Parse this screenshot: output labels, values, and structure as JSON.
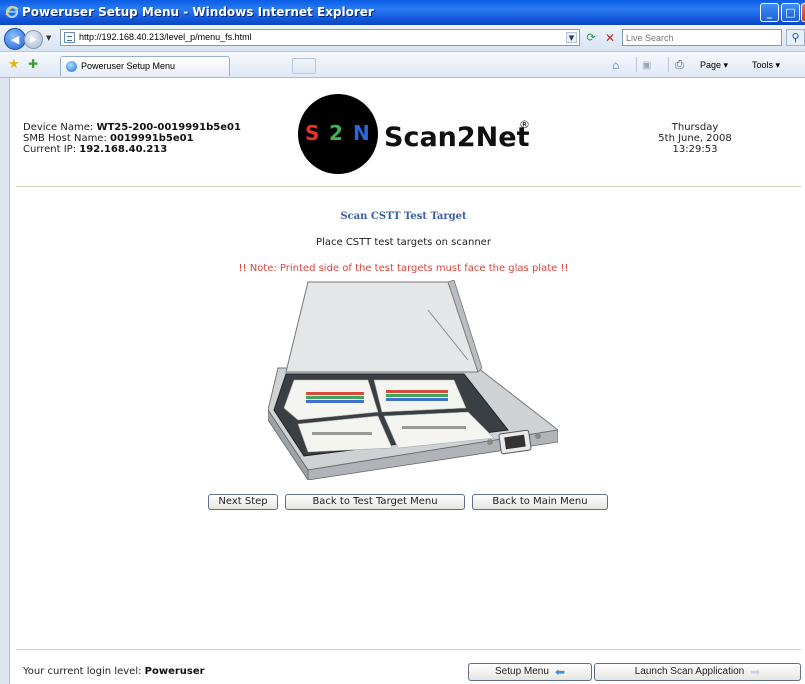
{
  "window": {
    "title": "Poweruser Setup Menu - Windows Internet Explorer"
  },
  "address_bar": {
    "url": "http://192.168.40.213/level_p/menu_fs.html",
    "search_placeholder": "Live Search"
  },
  "tabs": [
    {
      "label": "Poweruser Setup Menu"
    }
  ],
  "command_bar": {
    "page_label": "Page",
    "tools_label": "Tools"
  },
  "device": {
    "name_label": "Device Name:",
    "name_value": "WT25-200-0019991b5e01",
    "host_label": "SMB Host Name:",
    "host_value": "0019991b5e01",
    "ip_label": "Current IP:",
    "ip_value": "192.168.40.213"
  },
  "logo": {
    "s": "S",
    "two": "2",
    "n": "N",
    "text": "Scan2Net",
    "reg": "®"
  },
  "datetime": {
    "day": "Thursday",
    "date": "5th June, 2008",
    "time": "13:29:53"
  },
  "content": {
    "title": "Scan CSTT Test Target",
    "instruction": "Place CSTT test targets on scanner",
    "note": "!! Note: Printed side of the test targets must face the glas plate !!"
  },
  "buttons": {
    "next_step": "Next Step",
    "back_test_target": "Back to Test Target Menu",
    "back_main": "Back to Main Menu",
    "setup_menu": "Setup Menu",
    "launch_scan": "Launch Scan Application"
  },
  "footer": {
    "login_label": "Your current login level:",
    "login_value": "Poweruser"
  },
  "icons": {
    "back": "back-arrow-icon",
    "forward": "forward-arrow-icon",
    "refresh": "refresh-icon",
    "stop": "stop-icon",
    "search": "search-icon",
    "favorites": "favorites-star-icon",
    "add_favorites": "add-favorites-icon",
    "home": "home-icon",
    "feeds": "feeds-icon",
    "print": "print-icon",
    "scanner": "scanner-illustration-icon"
  },
  "colors": {
    "title_blue": "#3a5fa8",
    "note_red": "#d9433c",
    "titlebar": "#1258dc"
  }
}
